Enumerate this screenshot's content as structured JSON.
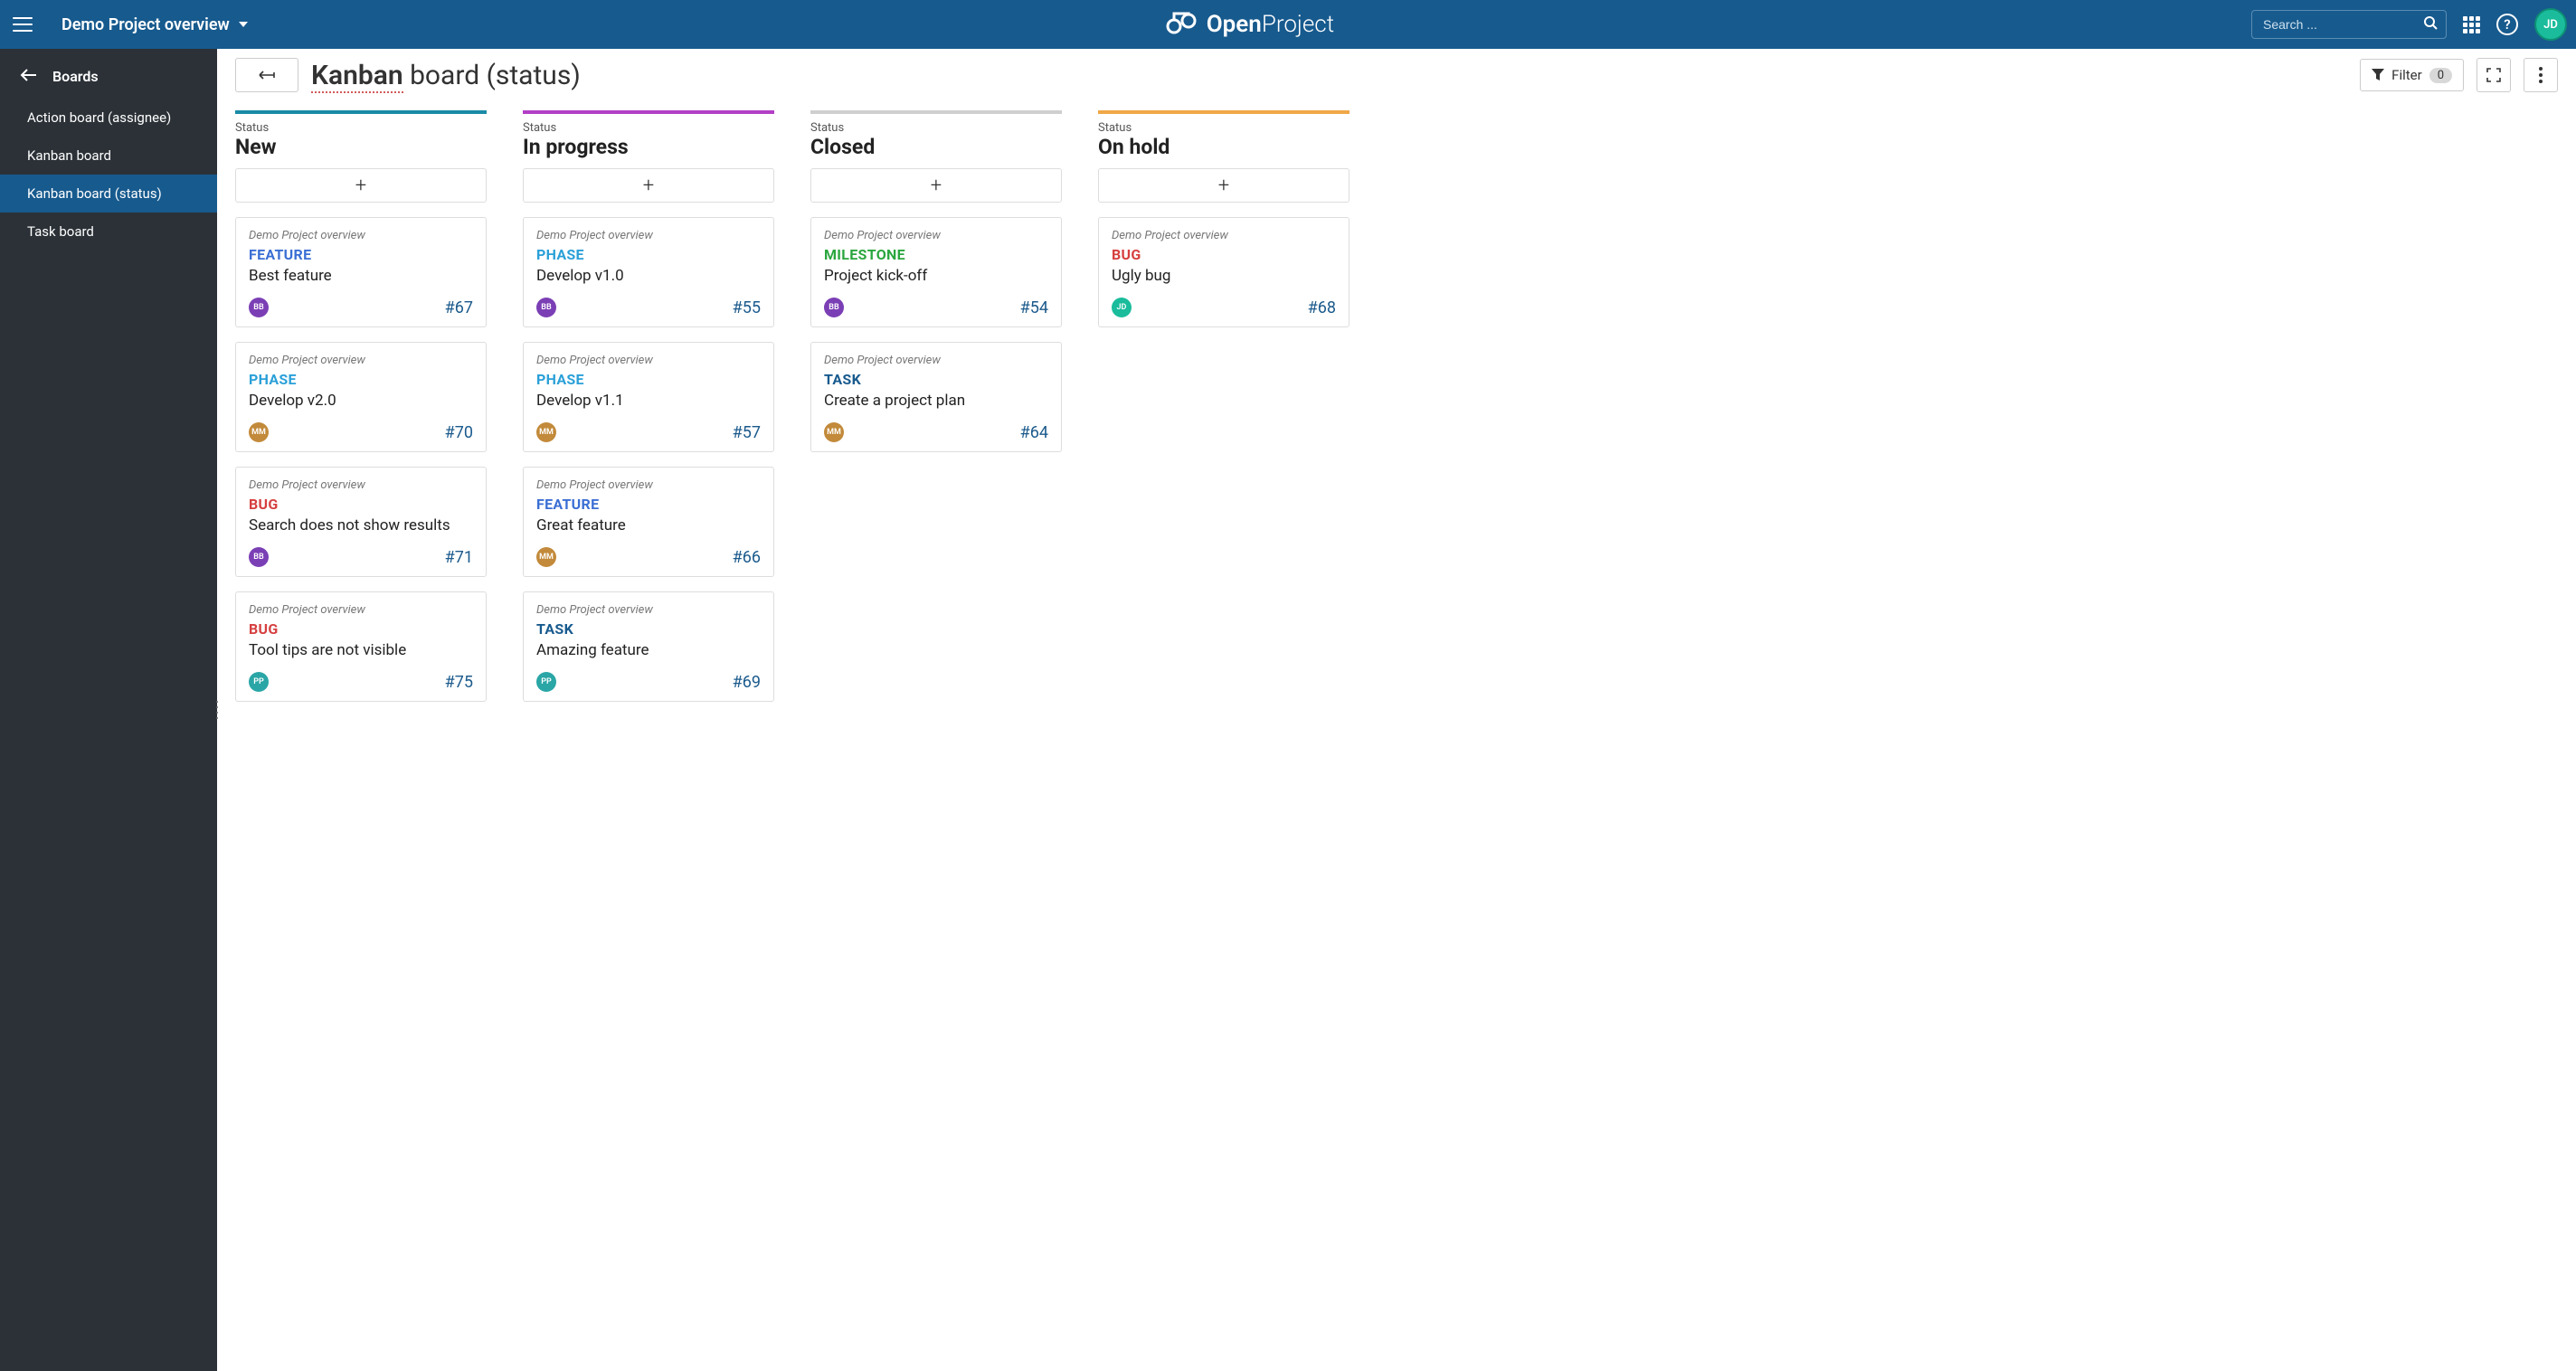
{
  "header": {
    "project_name": "Demo Project overview",
    "search_placeholder": "Search ...",
    "user_initials": "JD"
  },
  "sidebar": {
    "title": "Boards",
    "items": [
      {
        "label": "Action board (assignee)",
        "active": false
      },
      {
        "label": "Kanban board",
        "active": false
      },
      {
        "label": "Kanban board (status)",
        "active": true
      },
      {
        "label": "Task board",
        "active": false
      }
    ]
  },
  "toolbar": {
    "title_editable": "Kanban",
    "title_rest": " board (status)",
    "filter_label": "Filter",
    "filter_count": "0"
  },
  "type_colors": {
    "FEATURE": "type-feature",
    "PHASE": "type-phase",
    "BUG": "type-bug",
    "MILESTONE": "type-milestone",
    "TASK": "type-task"
  },
  "avatar_colors": {
    "BB": "#7b3fb5",
    "MM": "#c28a3a",
    "PP": "#2aa6a6",
    "JD": "#1abc9c"
  },
  "columns": [
    {
      "status_label": "Status",
      "name": "New",
      "bar_color": "#1a8aa6",
      "cards": [
        {
          "project": "Demo Project overview",
          "type": "FEATURE",
          "title": "Best feature",
          "assignee": "BB",
          "id": "#67"
        },
        {
          "project": "Demo Project overview",
          "type": "PHASE",
          "title": "Develop v2.0",
          "assignee": "MM",
          "id": "#70"
        },
        {
          "project": "Demo Project overview",
          "type": "BUG",
          "title": "Search does not show results",
          "assignee": "BB",
          "id": "#71"
        },
        {
          "project": "Demo Project overview",
          "type": "BUG",
          "title": "Tool tips are not visible",
          "assignee": "PP",
          "id": "#75"
        }
      ]
    },
    {
      "status_label": "Status",
      "name": "In progress",
      "bar_color": "#b23fc5",
      "cards": [
        {
          "project": "Demo Project overview",
          "type": "PHASE",
          "title": "Develop v1.0",
          "assignee": "BB",
          "id": "#55"
        },
        {
          "project": "Demo Project overview",
          "type": "PHASE",
          "title": "Develop v1.1",
          "assignee": "MM",
          "id": "#57"
        },
        {
          "project": "Demo Project overview",
          "type": "FEATURE",
          "title": "Great feature",
          "assignee": "MM",
          "id": "#66"
        },
        {
          "project": "Demo Project overview",
          "type": "TASK",
          "title": "Amazing feature",
          "assignee": "PP",
          "id": "#69"
        }
      ]
    },
    {
      "status_label": "Status",
      "name": "Closed",
      "bar_color": "#cfcfcf",
      "cards": [
        {
          "project": "Demo Project overview",
          "type": "MILESTONE",
          "title": "Project kick-off",
          "assignee": "BB",
          "id": "#54"
        },
        {
          "project": "Demo Project overview",
          "type": "TASK",
          "title": "Create a project plan",
          "assignee": "MM",
          "id": "#64"
        }
      ]
    },
    {
      "status_label": "Status",
      "name": "On hold",
      "bar_color": "#f0a748",
      "cards": [
        {
          "project": "Demo Project overview",
          "type": "BUG",
          "title": "Ugly bug",
          "assignee": "JD",
          "id": "#68"
        }
      ]
    }
  ]
}
